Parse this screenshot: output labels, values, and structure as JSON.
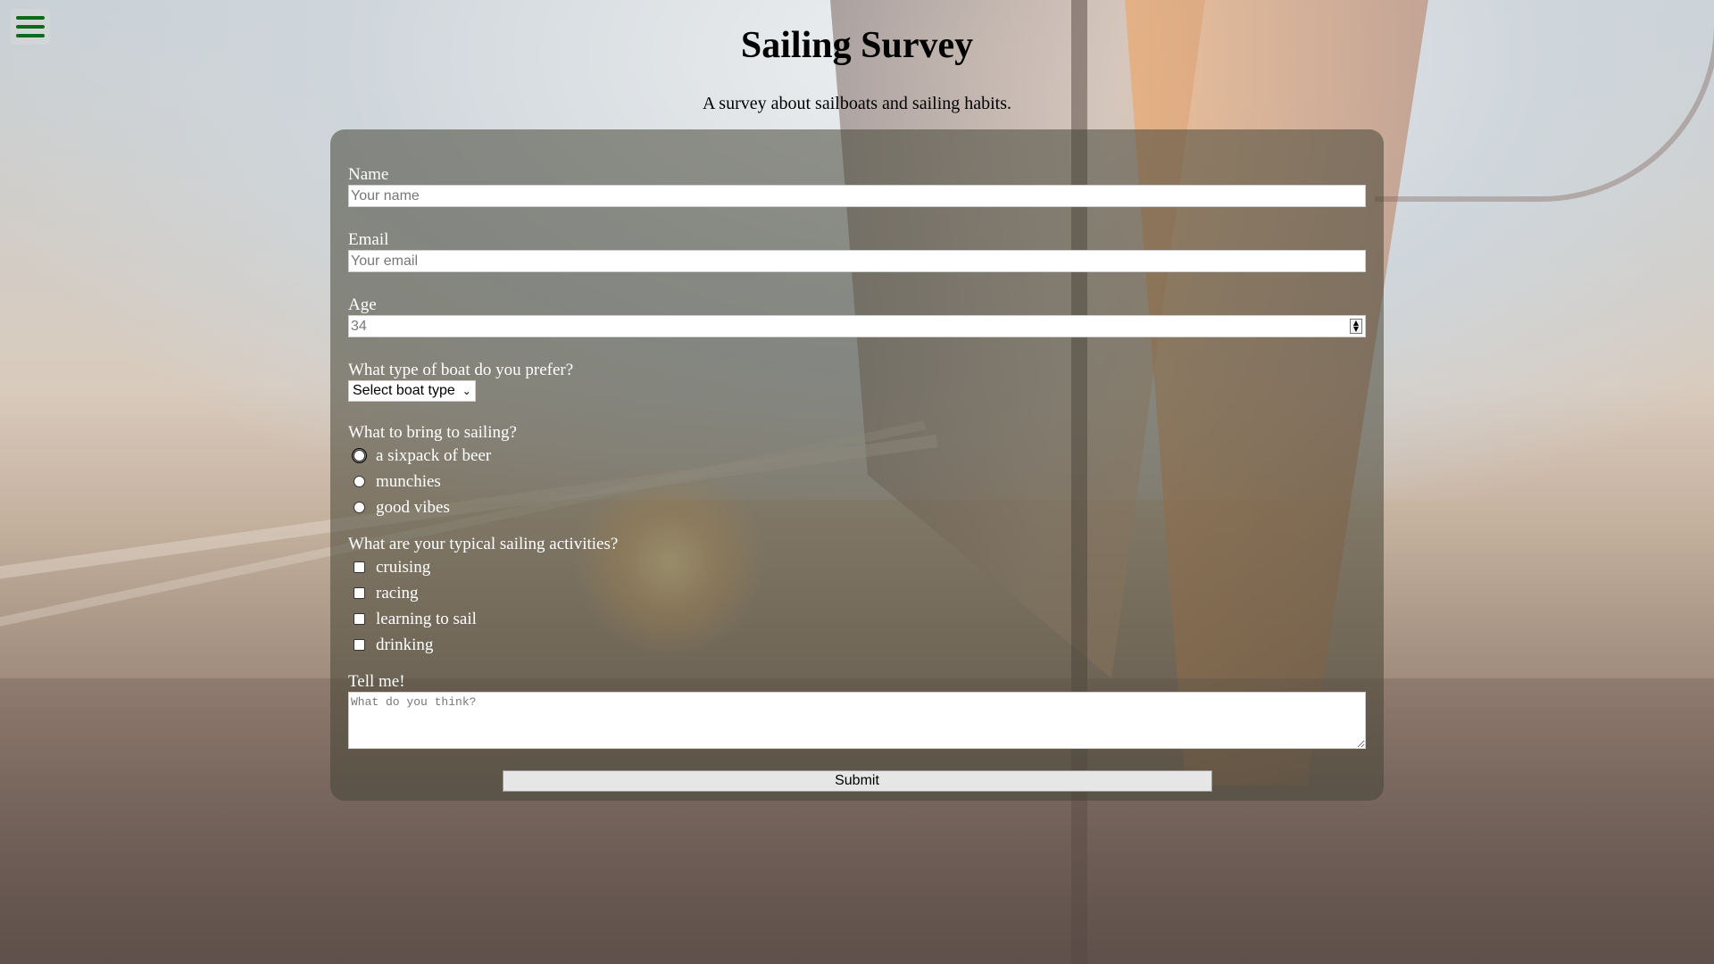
{
  "page": {
    "title": "Sailing Survey",
    "description": "A survey about sailboats and sailing habits."
  },
  "nav": {
    "menu_icon": "hamburger-icon",
    "menu_color": "#0b6b1a"
  },
  "form": {
    "name": {
      "label": "Name",
      "placeholder": "Your name"
    },
    "email": {
      "label": "Email",
      "placeholder": "Your email"
    },
    "age": {
      "label": "Age",
      "placeholder": "34"
    },
    "boat_type": {
      "label": "What type of boat do you prefer?",
      "selected": "Select boat type"
    },
    "bring": {
      "label": "What to bring to sailing?",
      "options": [
        "a sixpack of beer",
        "munchies",
        "good vibes"
      ]
    },
    "activities": {
      "label": "What are your typical sailing activities?",
      "options": [
        "cruising",
        "racing",
        "learning to sail",
        "drinking"
      ]
    },
    "comments": {
      "label": "Tell me!",
      "placeholder": "What do you think?"
    },
    "submit_label": "Submit"
  }
}
